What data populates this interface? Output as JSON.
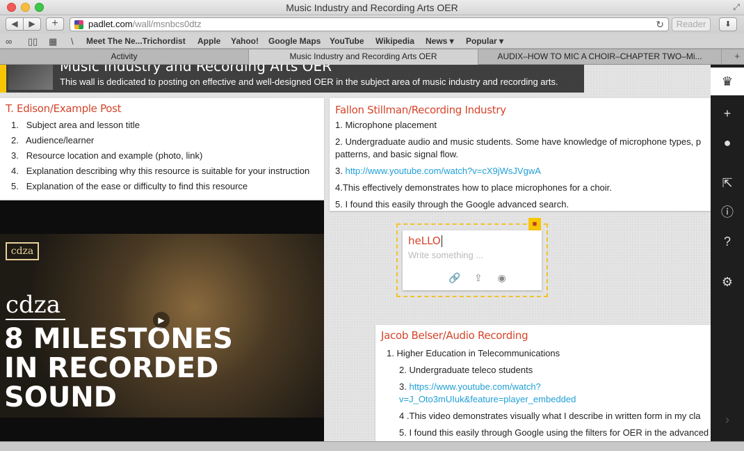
{
  "window": {
    "title": "Music Industry and Recording Arts OER"
  },
  "toolbar": {
    "back": "◀",
    "forward": "▶",
    "new_tab": "+",
    "url_host": "padlet.com",
    "url_path": "/wall/msnbcs0dtz",
    "reload": "↻",
    "reader": "Reader",
    "download": "⬇"
  },
  "bookmarks": {
    "icons": [
      "reading-list-icon",
      "book-icon",
      "grid-icon"
    ],
    "separator": "\\",
    "items": [
      "Meet The Ne...Trichordist",
      "Apple",
      "Yahoo!",
      "Google Maps",
      "YouTube",
      "Wikipedia",
      "News ▾",
      "Popular ▾"
    ]
  },
  "tabs": [
    {
      "label": "Activity"
    },
    {
      "label": "Music Industry and Recording Arts OER"
    },
    {
      "label": "AUDIX–HOW TO MIC A CHOIR–CHAPTER TWO–Mi..."
    }
  ],
  "wall": {
    "title": "Music Industry and Recording Arts OER",
    "description": "This wall is dedicated to posting on effective and well-designed OER in the subject area of music industry and recording arts."
  },
  "posts": {
    "edison": {
      "title": "T. Edison/Example Post",
      "items": [
        "Subject area and lesson title",
        "Audience/learner",
        "Resource location and example (photo, link)",
        "Explanation describing why this resource is suitable for your instruction",
        "Explanation of the ease or difficulty to find this resource"
      ]
    },
    "video": {
      "sign": "cdza",
      "logo": "cdza",
      "title_line1": "8 MILESTONES",
      "title_line2": "IN RECORDED",
      "title_line3": "SOUND"
    },
    "stillman": {
      "title": "Fallon Stillman/Recording Industry",
      "line1": "1. Microphone placement",
      "line2": "2. Undergraduate audio and music students. Some have knowledge of microphone types, p",
      "line2b": "patterns, and basic signal flow.",
      "line3_prefix": "3.",
      "line3_link": "http://www.youtube.com/watch?v=cX9jWsJVgwA",
      "line4": "4.This effectively demonstrates how to place microphones for a choir.",
      "line5": "5. I found this easily through the Google advanced search."
    },
    "new_post": {
      "title": "heLLO",
      "placeholder": "Write something ..."
    },
    "belser": {
      "title": "Jacob Belser/Audio Recording",
      "line1": "1.   Higher Education in Telecommunications",
      "line2": "2. Undergraduate teleco students",
      "line3_prefix": "3.",
      "line3_link": "https://www.youtube.com/watch?",
      "line3_link2": "v=J_Oto3mUIuk&feature=player_embedded",
      "line4": "4 .This video demonstrates visually what I describe in written form in my cla",
      "line5": "5. I found this easily through Google using the filters for OER in the advanced"
    }
  },
  "colors": {
    "accent": "#f7c600",
    "post_title": "#d4442a",
    "link": "#1f9fd6",
    "sidebar": "#1e1e1e"
  }
}
